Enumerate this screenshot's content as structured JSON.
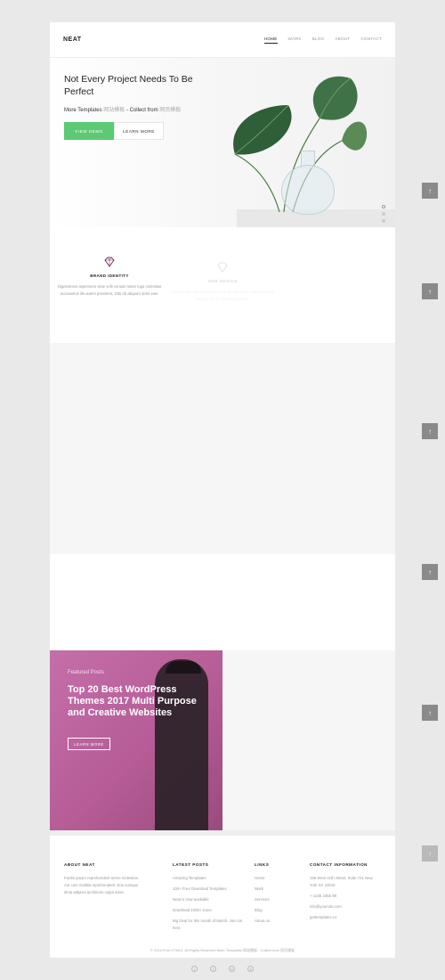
{
  "header": {
    "logo": "NEAT",
    "nav": [
      "HOME",
      "WORK",
      "BLOG",
      "ABOUT",
      "CONTACT"
    ]
  },
  "hero": {
    "title": "Not Every Project Needs To Be Perfect",
    "sub_prefix": "More Templates",
    "sub_tag1": "网站模板",
    "sub_mid": "- Collect from",
    "sub_tag2": "网页模板",
    "btn_primary": "VIEW DEMO",
    "btn_secondary": "LEARN MORE"
  },
  "features": [
    {
      "title": "BRAND IDENTITY",
      "text": "Dignissimos asperiores vitae velit veniam totam fuga molestias accusamus illo autem provident. Odit ab aliquam dolor eius."
    },
    {
      "title": "WEB DESIGN",
      "text": "Dignissimos asperiores vitae velit veniam totam fuga molestias accusamus illo autem provident."
    }
  ],
  "featured": {
    "label": "Featured Posts",
    "title": "Top 20 Best WordPress Themes 2017 Multi Purpose and Creative Websites",
    "button": "LEARN MORE"
  },
  "footer": {
    "about_title": "ABOUT NEAT",
    "about_text": "Facilis ipsum reprehenderit nemo molestias. Aut cum mollitia reprehenderit. Eos cumque dicta adipisci architecto culpa amet.",
    "posts_title": "LATEST POSTS",
    "posts": [
      "Amazing Templates",
      "100+ Free Download Templates",
      "Neat is now available",
      "Download 1000+ icons",
      "Big Deal for this month of March, Join Us here"
    ],
    "links_title": "LINKS",
    "links": [
      "Home",
      "Work",
      "Services",
      "Blog",
      "About us"
    ],
    "contact_title": "CONTACT INFORMATION",
    "contact": [
      "198 West 21th Street, Suite 721 New York NY 10016",
      "+ 1235 2355 98",
      "info@yoursite.com",
      "gettemplates.co"
    ],
    "copyright": "© 2016 Free HTML5. All Rights Reserved.More Templates 网站模板 - Collect from 网页模板",
    "socials": [
      "twitter-icon",
      "facebook-icon",
      "linkedin-icon",
      "dribbble-icon"
    ]
  },
  "colors": {
    "accent_green": "#5cc974",
    "featured_pink": "#c46fa8"
  }
}
